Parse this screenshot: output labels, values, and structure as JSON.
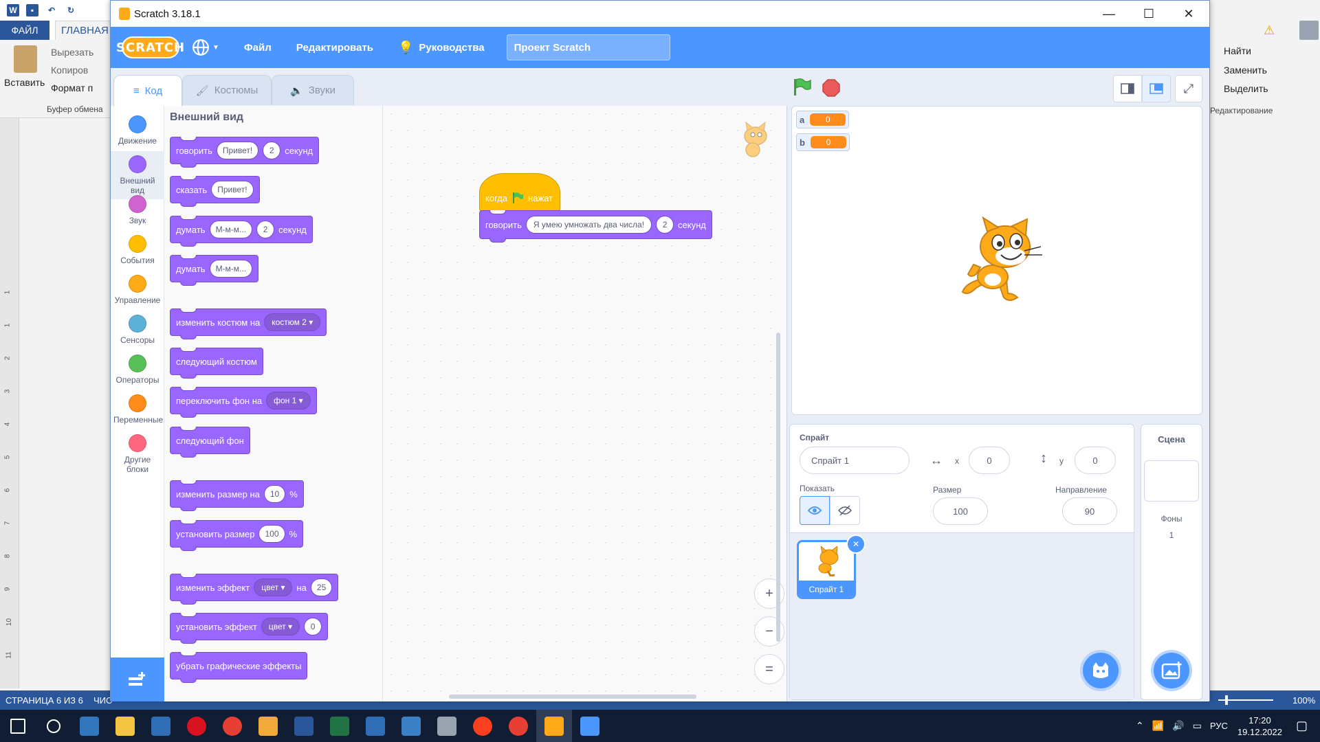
{
  "word": {
    "quick_access_icons": [
      "word-icon",
      "save-icon",
      "undo-icon",
      "redo-icon"
    ],
    "tab_file": "ФАЙЛ",
    "tab_home": "ГЛАВНАЯ",
    "paste": "Вставить",
    "cut": "Вырезать",
    "copy": "Копиров",
    "format": "Формат п",
    "clipboard_group": "Буфер обмена",
    "find": "Найти",
    "replace": "Заменить",
    "select": "Выделить",
    "editing_group": "Редактирование",
    "status_page": "СТРАНИЦА 6 ИЗ 6",
    "status_words": "ЧИС",
    "zoom": "100%",
    "ruler_numbers": [
      "1",
      "1",
      "2",
      "3",
      "4",
      "5",
      "6",
      "7",
      "8",
      "9",
      "10",
      "11"
    ]
  },
  "window": {
    "title": "Scratch 3.18.1",
    "minimize": "—",
    "maximize": "☐",
    "close": "✕"
  },
  "menu": {
    "logo": "SCRATCH",
    "file": "Файл",
    "edit": "Редактировать",
    "tutorials": "Руководства",
    "project_name": "Проект Scratch"
  },
  "tabs": {
    "code": "Код",
    "costumes": "Костюмы",
    "sounds": "Звуки"
  },
  "categories": [
    {
      "label": "Движение",
      "color": "#4c97ff"
    },
    {
      "label": "Внешний вид",
      "color": "#9966ff"
    },
    {
      "label": "Звук",
      "color": "#cf63cf"
    },
    {
      "label": "События",
      "color": "#ffbf00"
    },
    {
      "label": "Управление",
      "color": "#ffab19"
    },
    {
      "label": "Сенсоры",
      "color": "#5cb1d6"
    },
    {
      "label": "Операторы",
      "color": "#59c059"
    },
    {
      "label": "Переменные",
      "color": "#ff8c1a"
    },
    {
      "label": "Другие блоки",
      "color": "#ff6680"
    }
  ],
  "palette": {
    "heading": "Внешний вид",
    "blocks": {
      "say_secs": {
        "t1": "говорить",
        "v1": "Привет!",
        "v2": "2",
        "t2": "секунд"
      },
      "say": {
        "t1": "сказать",
        "v1": "Привет!"
      },
      "think_secs": {
        "t1": "думать",
        "v1": "М-м-м...",
        "v2": "2",
        "t2": "секунд"
      },
      "think": {
        "t1": "думать",
        "v1": "М-м-м..."
      },
      "switch_costume": {
        "t1": "изменить костюм на",
        "d1": "костюм 2"
      },
      "next_costume": {
        "t1": "следующий костюм"
      },
      "switch_backdrop": {
        "t1": "переключить фон на",
        "d1": "фон 1"
      },
      "next_backdrop": {
        "t1": "следующий фон"
      },
      "change_size": {
        "t1": "изменить размер на",
        "v1": "10",
        "t2": "%"
      },
      "set_size": {
        "t1": "установить размер",
        "v1": "100",
        "t2": "%"
      },
      "change_effect": {
        "t1": "изменить эффект",
        "d1": "цвет",
        "t2": "на",
        "v1": "25"
      },
      "set_effect": {
        "t1": "установить эффект",
        "d1": "цвет",
        "v1": "0"
      },
      "clear_effects": {
        "t1": "убрать графические эффекты"
      }
    }
  },
  "script": {
    "hat_when": "когда",
    "hat_clicked": "нажат",
    "say_label": "говорить",
    "say_text": "Я умею умножать два числа!",
    "say_secs": "2",
    "say_unit": "секунд"
  },
  "zoom": {
    "in": "+",
    "out": "−",
    "reset": "="
  },
  "monitors": [
    {
      "name": "a",
      "value": "0"
    },
    {
      "name": "b",
      "value": "0"
    }
  ],
  "sprite_info": {
    "sprite_label": "Спрайт",
    "sprite_name": "Спрайт 1",
    "x_label": "x",
    "x_value": "0",
    "y_label": "y",
    "y_value": "0",
    "show_label": "Показать",
    "size_label": "Размер",
    "size_value": "100",
    "direction_label": "Направление",
    "direction_value": "90"
  },
  "sprites": [
    {
      "name": "Спрайт 1",
      "selected": true
    }
  ],
  "stage_panel": {
    "title": "Сцена",
    "backdrops_label": "Фоны",
    "backdrops_count": "1"
  },
  "taskbar": {
    "apps": [
      "start-icon",
      "search-icon",
      "edge-icon",
      "explorer-icon",
      "disk-icon",
      "opera-icon",
      "chrome-icon",
      "paint-icon",
      "word-icon",
      "excel-icon",
      "calculator-icon",
      "presentation-icon",
      "printer-icon",
      "yandex-icon",
      "chrome-profile-icon",
      "scratch-icon",
      "snipping-icon"
    ],
    "language": "РУС",
    "time": "17:20",
    "date": "19.12.2022"
  },
  "colors": {
    "scratch_blue": "#4c97ff",
    "looks_purple": "#9966ff",
    "events_yellow": "#ffbf00",
    "variables_orange": "#ff8c1a",
    "word_blue": "#2b579a"
  }
}
